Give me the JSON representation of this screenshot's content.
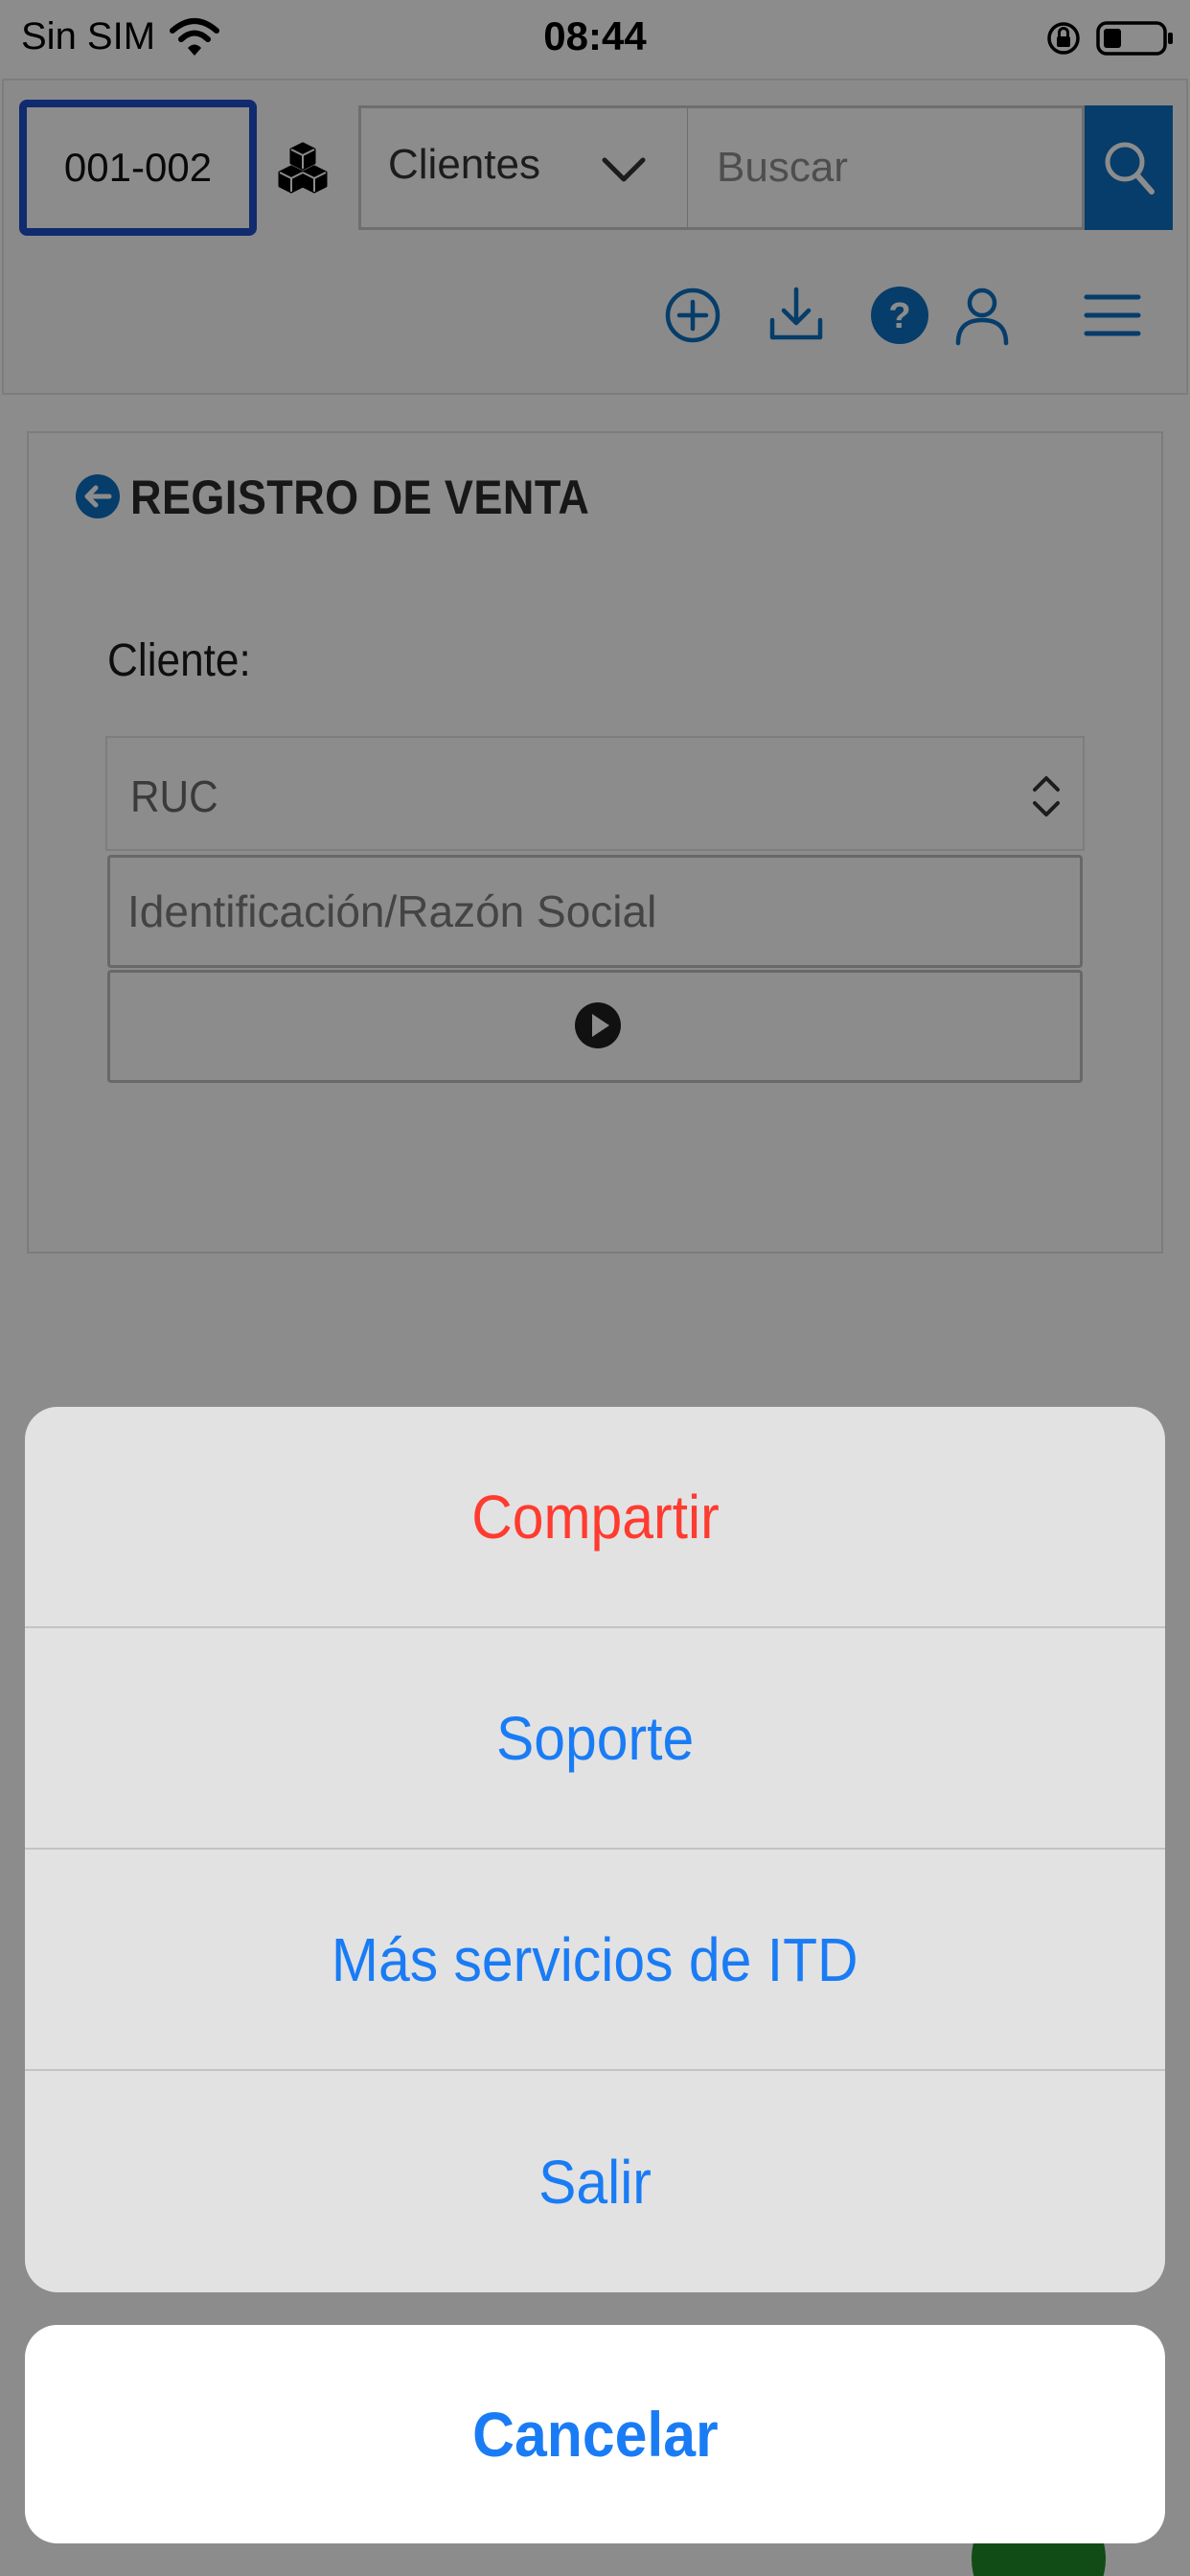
{
  "status_bar": {
    "carrier": "Sin SIM",
    "time": "08:44"
  },
  "header": {
    "branch_code": "001-002",
    "entity_select": "Clientes",
    "search_placeholder": "Buscar"
  },
  "form": {
    "title": "REGISTRO DE VENTA",
    "client_label": "Cliente:",
    "id_type_selected": "RUC",
    "id_placeholder": "Identificación/Razón Social"
  },
  "action_sheet": {
    "items": [
      {
        "label": "Compartir",
        "style": "destructive"
      },
      {
        "label": "Soporte",
        "style": "default"
      },
      {
        "label": "Más servicios de ITD",
        "style": "default"
      },
      {
        "label": "Salir",
        "style": "default"
      }
    ],
    "cancel_label": "Cancelar"
  },
  "colors": {
    "accent": "#1a7cf5",
    "destructive": "#ff3b30",
    "header_icon": "#0b6fc2",
    "branch_border": "#1e4fc8"
  }
}
